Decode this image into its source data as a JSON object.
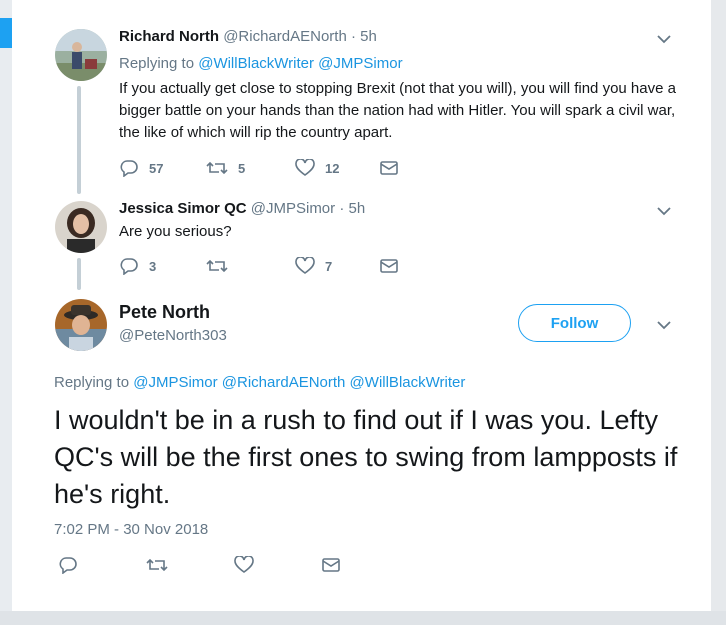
{
  "tweets": [
    {
      "name": "Richard North",
      "handle": "@RichardAENorth",
      "time": "· 5h",
      "replying_prefix": "Replying to",
      "replying_to": "@WillBlackWriter @JMPSimor",
      "text": "If you actually get close to stopping Brexit (not that you will), you will find you have a bigger battle on your hands than the nation had with Hitler. You will spark a civil war, the like of which will rip the country apart.",
      "replies": "57",
      "retweets": "5",
      "likes": "12"
    },
    {
      "name": "Jessica Simor QC",
      "handle": "@JMPSimor",
      "time": "· 5h",
      "text": "Are you serious?",
      "replies": "3",
      "retweets": "",
      "likes": "7"
    }
  ],
  "main_tweet": {
    "name": "Pete North",
    "handle": "@PeteNorth303",
    "follow_label": "Follow",
    "replying_prefix": "Replying to",
    "replying_to": "@JMPSimor @RichardAENorth @WillBlackWriter",
    "text": "I wouldn't be in a rush to find out if I was you. Lefty QC's will be the first ones to swing from lampposts if he's right.",
    "timestamp": "7:02 PM - 30 Nov 2018"
  },
  "colors": {
    "link": "#1b95e0",
    "accent": "#1da1f2",
    "muted": "#657786",
    "text": "#14171a"
  },
  "icons": {
    "reply": "reply-icon",
    "retweet": "retweet-icon",
    "like": "heart-icon",
    "dm": "envelope-icon",
    "more": "chevron-down-icon"
  }
}
